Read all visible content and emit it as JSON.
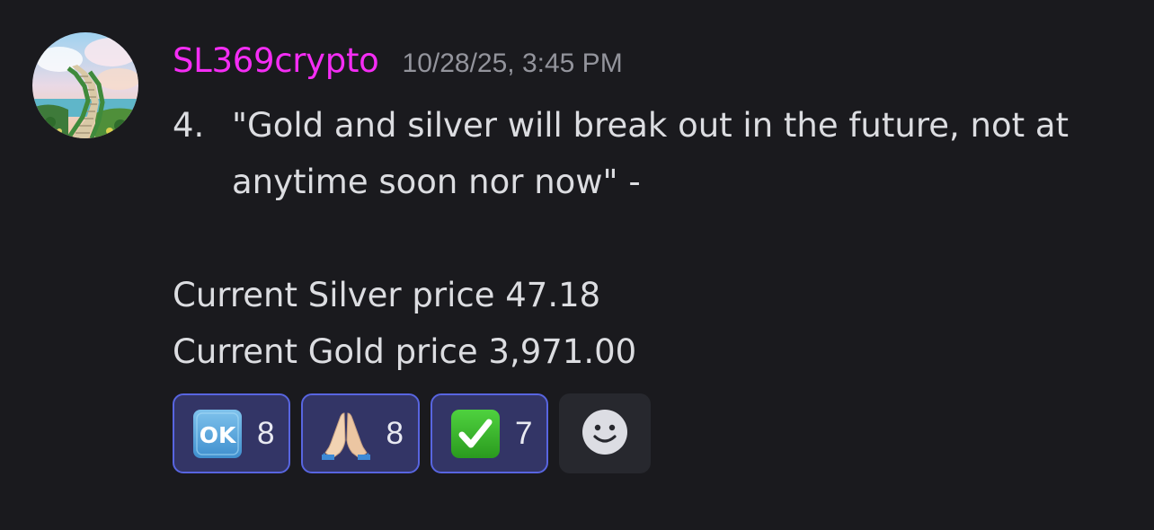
{
  "message": {
    "author": "SL369crypto",
    "author_color": "#f42df4",
    "timestamp": "10/28/25, 3:45 PM",
    "avatar_icon": "stairway-landscape-avatar",
    "list_number": "4.",
    "list_text": "\"Gold and silver will break out in the future, not at anytime soon nor now\" -",
    "lines": [
      "Current Silver price 47.18",
      "Current Gold price 3,971.00"
    ]
  },
  "reactions": [
    {
      "icon": "ok-button-icon",
      "count": "8"
    },
    {
      "icon": "folded-hands-icon",
      "count": "8"
    },
    {
      "icon": "check-mark-button-icon",
      "count": "7"
    }
  ],
  "add_reaction_icon": "smiley-face-icon",
  "colors": {
    "background": "#1a1a1e",
    "text": "#dcdde1",
    "timestamp": "#93949c",
    "reaction_border": "#5865e0",
    "reaction_bg": "#333566"
  }
}
